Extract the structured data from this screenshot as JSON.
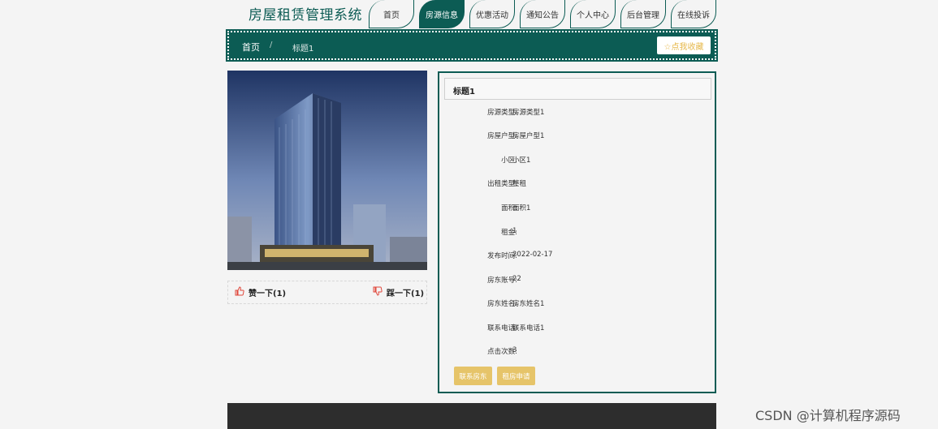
{
  "site_title": "房屋租赁管理系统",
  "nav": [
    "首页",
    "房源信息",
    "优惠活动",
    "通知公告",
    "个人中心",
    "后台管理",
    "在线投诉"
  ],
  "nav_active_index": 1,
  "breadcrumb": {
    "home": "首页",
    "separator": "/",
    "current": "标题1"
  },
  "favorite_button": "☆点我收藏",
  "vote": {
    "like_label": "赞一下(1)",
    "dislike_label": "踩一下(1)"
  },
  "detail": {
    "title": "标题1",
    "fields": [
      {
        "label": "房源类型:",
        "value": "房源类型1"
      },
      {
        "label": "房屋户型:",
        "value": "房屋户型1"
      },
      {
        "label": "小区:",
        "value": "小区1"
      },
      {
        "label": "出租类型:",
        "value": "整租"
      },
      {
        "label": "面积:",
        "value": "面积1"
      },
      {
        "label": "租金:",
        "value": "1"
      },
      {
        "label": "发布时间:",
        "value": "2022-02-17"
      },
      {
        "label": "房东账号:",
        "value": "22"
      },
      {
        "label": "房东姓名:",
        "value": "房东姓名1"
      },
      {
        "label": "联系电话:",
        "value": "联系电话1"
      },
      {
        "label": "点击次数:",
        "value": "3"
      }
    ],
    "buttons": [
      "联系房东",
      "租房申请"
    ]
  },
  "watermark": "CSDN @计算机程序源码",
  "colors": {
    "primary": "#0c5c54",
    "accent": "#e6c469",
    "footer": "#2d2d2d"
  }
}
